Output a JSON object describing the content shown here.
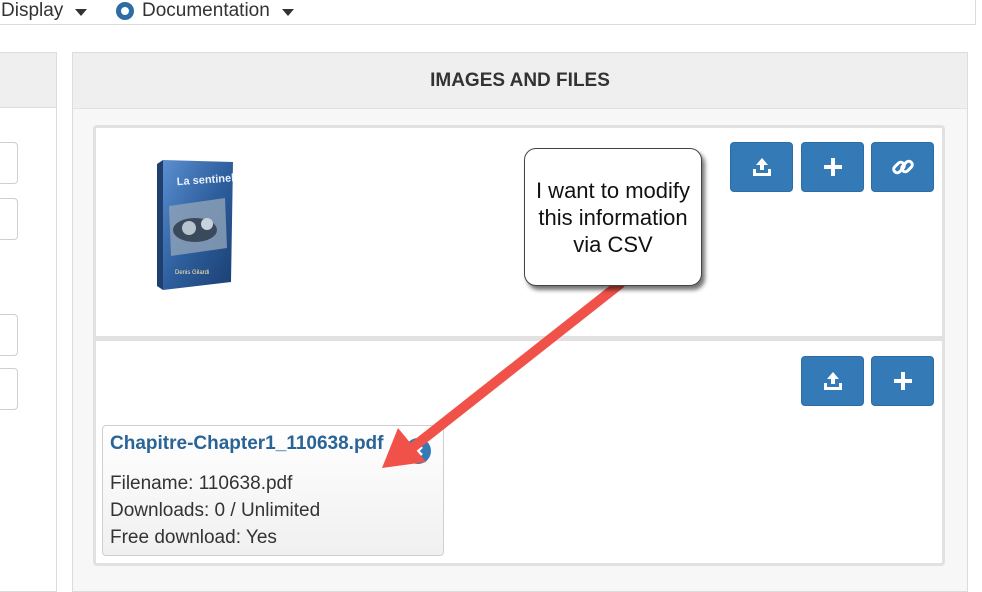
{
  "topnav": {
    "display_label": "Display",
    "documentation_label": "Documentation"
  },
  "panel": {
    "title": "IMAGES AND FILES"
  },
  "images": {
    "buttons": [
      {
        "name": "upload-image-button",
        "icon": "upload-icon"
      },
      {
        "name": "add-image-button",
        "icon": "plus-icon"
      },
      {
        "name": "link-image-button",
        "icon": "link-icon"
      }
    ],
    "thumbnail": {
      "title_text": "La sentinelle",
      "author_text": "Denis Gilardi"
    }
  },
  "files": {
    "buttons": [
      {
        "name": "upload-file-button",
        "icon": "upload-icon"
      },
      {
        "name": "add-file-button",
        "icon": "plus-icon"
      }
    ],
    "file": {
      "link_text": "Chapitre-Chapter1_110638.pdf",
      "filename": "Filename: 110638.pdf",
      "downloads": "Downloads: 0 / Unlimited",
      "free_download": "Free download: Yes"
    }
  },
  "annotation": {
    "callout_text": "I want to modify this information via CSV",
    "arrow_color": "#f0524a"
  },
  "colors": {
    "primary": "#337ab7",
    "link": "#2a6496"
  }
}
